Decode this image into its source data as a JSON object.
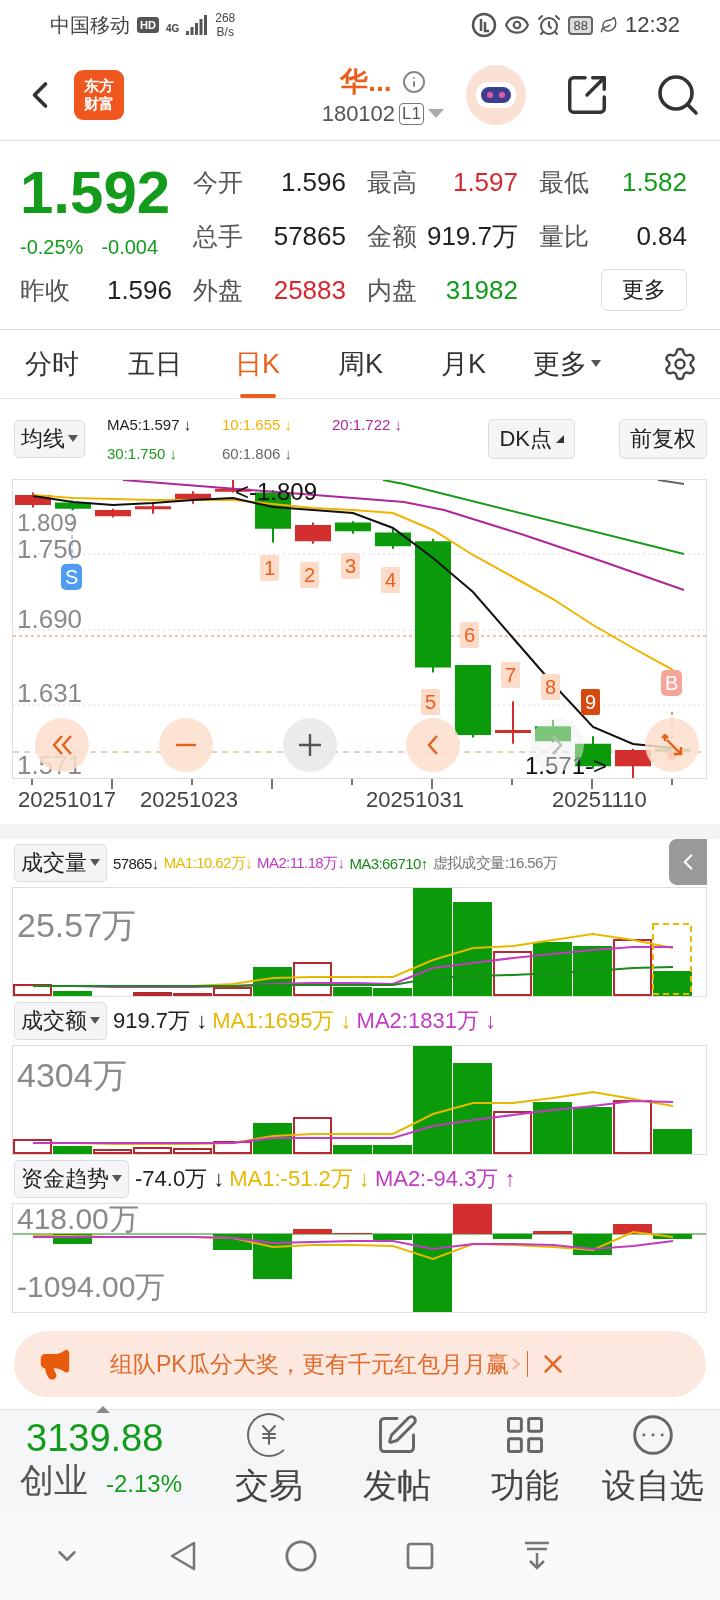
{
  "status_bar": {
    "carrier": "中国移动",
    "network_badge": "HD",
    "network_type": "4G",
    "speed_value": "268",
    "speed_unit": "B/s",
    "battery": "88",
    "time": "12:32"
  },
  "header": {
    "logo": [
      "东方",
      "财富"
    ],
    "title": "华...",
    "code": "180102",
    "level_badge": "L1"
  },
  "quote": {
    "price": "1.592",
    "change_pct": "-0.25%",
    "change": "-0.004",
    "color": "#139c1b",
    "fields": [
      {
        "label": "今开",
        "value": "1.596",
        "color": "#222222"
      },
      {
        "label": "最高",
        "value": "1.597",
        "color": "#d8282e"
      },
      {
        "label": "最低",
        "value": "1.582",
        "color": "#139c1b"
      },
      {
        "label": "总手",
        "value": "57865",
        "color": "#222222"
      },
      {
        "label": "金额",
        "value": "919.7万",
        "color": "#222222"
      },
      {
        "label": "量比",
        "value": "0.84",
        "color": "#222222"
      },
      {
        "label": "昨收",
        "value": "1.596",
        "color": "#222222"
      },
      {
        "label": "外盘",
        "value": "25883",
        "color": "#d8282e"
      },
      {
        "label": "内盘",
        "value": "31982",
        "color": "#139c1b"
      }
    ],
    "more_button": "更多"
  },
  "tabs": [
    {
      "label": "分时",
      "selected": false,
      "dropdown": false
    },
    {
      "label": "五日",
      "selected": false,
      "dropdown": false
    },
    {
      "label": "日K",
      "selected": true,
      "dropdown": false
    },
    {
      "label": "周K",
      "selected": false,
      "dropdown": false
    },
    {
      "label": "月K",
      "selected": false,
      "dropdown": false
    },
    {
      "label": "更多",
      "selected": false,
      "dropdown": true
    }
  ],
  "ma_legend": {
    "selector": "均线",
    "items": [
      {
        "text": "MA5:1.597 ↓",
        "color": "#222222"
      },
      {
        "text": "10:1.655 ↓",
        "color": "#f0b400"
      },
      {
        "text": "20:1.722 ↓",
        "color": "#b0279c"
      },
      {
        "text": "30:1.750 ↓",
        "color": "#1a9a1a"
      },
      {
        "text": "60:1.806 ↓",
        "color": "#666666"
      }
    ],
    "buttons": [
      "DK点",
      "前复权"
    ]
  },
  "price_chart": {
    "y_labels": [
      "1.809",
      "1.750",
      "1.690",
      "1.631",
      "1.571"
    ],
    "x_labels": [
      "20251017",
      "20251023",
      "20251031",
      "20251110"
    ],
    "high_label": "<-1.809",
    "low_label": "1.571->",
    "markers": [
      {
        "text": "1",
        "kind": "count"
      },
      {
        "text": "2",
        "kind": "count"
      },
      {
        "text": "3",
        "kind": "count"
      },
      {
        "text": "4",
        "kind": "count"
      },
      {
        "text": "5",
        "kind": "count"
      },
      {
        "text": "6",
        "kind": "count"
      },
      {
        "text": "7",
        "kind": "count"
      },
      {
        "text": "8",
        "kind": "count"
      },
      {
        "text": "9",
        "kind": "count_strong"
      },
      {
        "text": "S",
        "kind": "sell"
      },
      {
        "text": "B",
        "kind": "buy"
      }
    ]
  },
  "indicators": [
    {
      "kind": "volume",
      "selector": "成交量",
      "collapse_tab": true,
      "scale_labels": [
        "25.57万"
      ],
      "values": [
        {
          "text": "57865↓",
          "color": "#222222"
        },
        {
          "text": "MA1:10.62万↓",
          "color": "#e6b800"
        },
        {
          "text": "MA2:11.18万↓",
          "color": "#c23bc2"
        },
        {
          "text": "MA3:66710↑",
          "color": "#1a8a1a"
        },
        {
          "text": "虚拟成交量:16.56万",
          "color": "#777777"
        }
      ]
    },
    {
      "kind": "amount",
      "selector": "成交额",
      "collapse_tab": false,
      "scale_labels": [
        "4304万"
      ],
      "values": [
        {
          "text": "919.7万 ↓",
          "color": "#222222"
        },
        {
          "text": "MA1:1695万 ↓",
          "color": "#e6b800"
        },
        {
          "text": "MA2:1831万 ↓",
          "color": "#c23bc2"
        }
      ]
    },
    {
      "kind": "flow",
      "selector": "资金趋势",
      "collapse_tab": false,
      "scale_labels": [
        "418.00万",
        "-1094.00万"
      ],
      "values": [
        {
          "text": "-74.0万 ↓",
          "color": "#222222"
        },
        {
          "text": "MA1:-51.2万 ↓",
          "color": "#e6b800"
        },
        {
          "text": "MA2:-94.3万 ↑",
          "color": "#c23bc2"
        }
      ]
    }
  ],
  "banner": {
    "text": "组队PK瓜分大奖，更有千元红包月月赢"
  },
  "bottom_bar": {
    "index": {
      "value": "3139.88",
      "name": "创业",
      "change": "-2.13%",
      "color": "#139c1b"
    },
    "actions": [
      {
        "label": "交易",
        "kind": "trade"
      },
      {
        "label": "发帖",
        "kind": "post"
      },
      {
        "label": "功能",
        "kind": "apps"
      },
      {
        "label": "设自选",
        "kind": "more"
      }
    ]
  }
}
